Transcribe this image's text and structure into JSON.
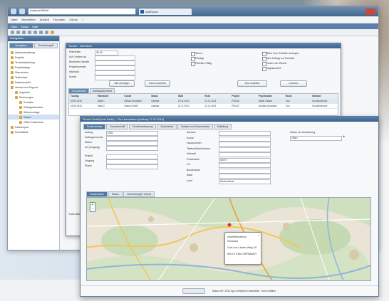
{
  "browser": {
    "address": "localhost:8080/#/",
    "tab_label": "AddRoute",
    "menu": [
      "Datei",
      "Bearbeiten",
      "Ansicht",
      "Favoriten",
      "Extras",
      "?"
    ]
  },
  "app_nav": [
    "Datei",
    "Modul",
    "Hilfe"
  ],
  "sidebar": {
    "title": "Navigation",
    "tabs": [
      "Navigation",
      "Schnellzugriff"
    ],
    "items": [
      {
        "label": "Adressverwaltung",
        "level": 0
      },
      {
        "label": "Projekte",
        "level": 0
      },
      {
        "label": "Termindarstellung",
        "level": 0
      },
      {
        "label": "Projektwaage",
        "level": 0
      },
      {
        "label": "Übersichten",
        "level": 0
      },
      {
        "label": "Telefonliste",
        "level": 0
      },
      {
        "label": "Datenauswahl",
        "level": 0
      },
      {
        "label": "Verkauf und Support",
        "level": 0
      },
      {
        "label": "Angebote",
        "level": 1
      },
      {
        "label": "Rechnungen",
        "level": 1
      },
      {
        "label": "Kontakte",
        "level": 2
      },
      {
        "label": "Auftragsübersicht",
        "level": 2
      },
      {
        "label": "Wiedervorlage",
        "level": 2
      },
      {
        "label": "Touren",
        "level": 2
      },
      {
        "label": "Office-Dokumente",
        "level": 2
      },
      {
        "label": "Datenimport",
        "level": 0
      },
      {
        "label": "Schnittstelle",
        "level": 0
      }
    ]
  },
  "dialog1": {
    "title": "Touren - Übersicht",
    "filter_labels": [
      "Filterfelder",
      "Auf Geräten ab",
      "Bearbeiter Sendte",
      "Projektnummer",
      "Nachlauf",
      "Kunde"
    ],
    "filter_value": "30.09",
    "checkboxes": [
      "Storno",
      "Erledigt",
      "Pflichten-Fällig"
    ],
    "right_checks": [
      "Beim Tour-Erstellen anzeigen",
      "Neu-Auftrag zur Tourstart",
      "Touren der Woche",
      "Tagesansicht"
    ],
    "buttons": [
      "Alle anzeigen",
      "Touren aufrufen",
      "Tour erstellen",
      "Löschen"
    ],
    "tabs": [
      "Tourübersicht",
      "Auftragsübersicht"
    ],
    "grid_headers": [
      "Tourtag",
      "Fahrtstufe",
      "Kunde",
      "Status",
      "Start",
      "Ende",
      "Projekt",
      "Projektname",
      "Route",
      "Besitzer"
    ],
    "grid_rows": [
      [
        "09.09.2013",
        "Stufe 1",
        "GEMA Großraum",
        "Geplant",
        "20.11.2013",
        "21.11.2013",
        "P00134",
        "Müller-Straße",
        "Tour",
        "Kundenservice"
      ],
      [
        "09.09.2013",
        "Stufe 2",
        "Hansa GmbH",
        "Geplant",
        "21.11.2013",
        "22.11.2013",
        "P00137",
        "Neubau-Kranhalle",
        "Tour",
        "Kundenservice"
      ]
    ],
    "bottom_text": "Tourenübersicht"
  },
  "dialog2": {
    "title": "Touren-Detail (aus Karte) – Tour bearbeiten (Auftrag 17.11.2013)",
    "tabs": [
      "Routendetails",
      "Touraufschrift",
      "Berichtserfassung",
      "Dokumente",
      "Notizen und Kommentare",
      "Mitteilung"
    ],
    "left_labels": [
      "Auftrag",
      "Auftragsnummer",
      "Status",
      "Art (Vorgang)",
      "Projekt",
      "Vorgang",
      "Phase"
    ],
    "left_values": [
      "1001",
      "",
      "",
      "",
      "",
      "",
      ""
    ],
    "mid_labels": [
      "Adresse",
      "Kunde",
      "Hausnummer",
      "Telefon/Mobilnummer",
      "Verkauft",
      "Postleitzahl",
      "Ort",
      "Bundesland",
      "Staat",
      "Land"
    ],
    "mid_values": [
      "",
      "",
      "",
      "",
      "",
      "52072",
      "",
      "",
      "",
      "Deutschland"
    ],
    "right_label": "Status der Auswertung",
    "right_value": "Offen",
    "map_tabs": [
      "Routendaten",
      "Status",
      "Vermerkungen Tourist"
    ],
    "map_popup": {
      "line1": "Architekturbüro",
      "line2": "Schwarz",
      "line3": "Carl-vor-Linien-Weg 10",
      "line4": "52072 Köln GERMANY"
    },
    "status_text": "Status 99 | 2013 App erfolgreich bearbeitet. Tour erstellen."
  }
}
